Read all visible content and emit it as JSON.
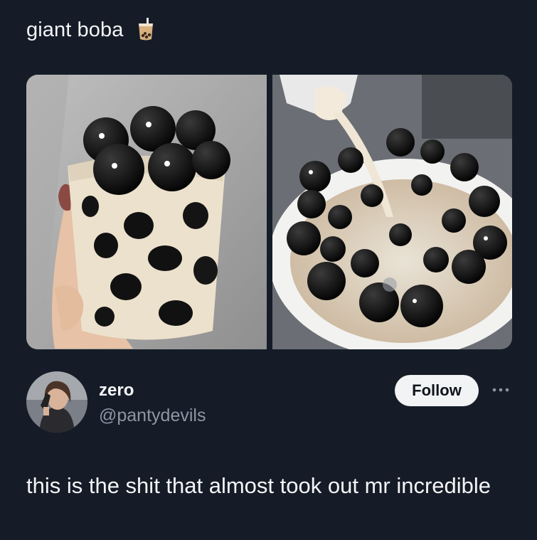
{
  "quoted_post": {
    "text": "giant boba",
    "emoji_icon": "bubble-tea-icon"
  },
  "media": [
    {
      "name": "boba-cup-photo",
      "description_icon": "photo"
    },
    {
      "name": "boba-pouring-milk-photo",
      "description_icon": "photo"
    }
  ],
  "author": {
    "display_name": "zero",
    "handle": "@pantydevils"
  },
  "actions": {
    "follow_label": "Follow",
    "more_icon": "more-horizontal-icon"
  },
  "post": {
    "text": "this is the shit that almost took out mr incredible"
  },
  "colors": {
    "background": "#151c27",
    "text": "#f3f4f6",
    "muted": "#8c96a4",
    "follow_bg": "#f2f3f5"
  }
}
